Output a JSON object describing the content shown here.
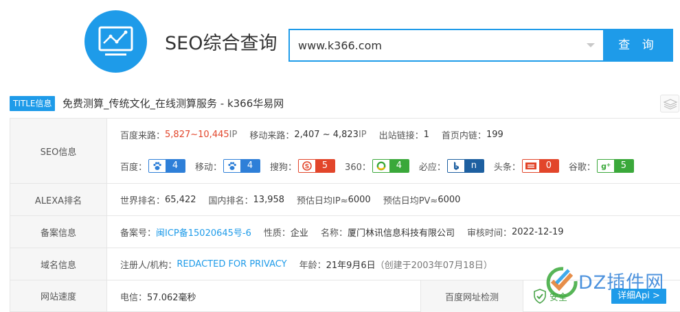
{
  "header": {
    "app_title": "SEO综合查询",
    "search_value": "www.k366.com",
    "search_button": "查 询"
  },
  "title_row": {
    "badge": "TITLE信息",
    "text": "免费测算_传统文化_在线测算服务 - k366华易网"
  },
  "seo": {
    "label": "SEO信息",
    "baidu_traffic_label": "百度来路：",
    "baidu_traffic_min": "5,827",
    "baidu_traffic_sep": " ~ ",
    "baidu_traffic_max": "10,445",
    "baidu_traffic_unit": " IP",
    "mobile_traffic_label": "移动来路：",
    "mobile_traffic_value": "2,407 ~ 4,823",
    "mobile_traffic_unit": " IP",
    "outlinks_label": "出站链接：",
    "outlinks_value": "1",
    "homepage_links_label": "首页内链：",
    "homepage_links_value": "199",
    "ranks": [
      {
        "label": "百度：",
        "icon": "paw-icon",
        "value": "4",
        "color": "#2e7fd8"
      },
      {
        "label": "移动：",
        "icon": "paw-icon",
        "value": "4",
        "color": "#2e7fd8"
      },
      {
        "label": "搜狗：",
        "icon": "sogou-icon",
        "value": "5",
        "color": "#e2452a"
      },
      {
        "label": "360：",
        "icon": "360-icon",
        "value": "4",
        "color": "#3aa83a"
      },
      {
        "label": "必应：",
        "icon": "bing-icon",
        "value": "n",
        "color": "#1d5fa0"
      },
      {
        "label": "头条：",
        "icon": "toutiao-icon",
        "value": "0",
        "color": "#e2452a"
      },
      {
        "label": "谷歌：",
        "icon": "google-plus-icon",
        "value": "5",
        "color": "#3aa83a"
      }
    ]
  },
  "alexa": {
    "label": "ALEXA排名",
    "world_label": "世界排名：",
    "world_value": "65,422",
    "domestic_label": "国内排名：",
    "domestic_value": "13,958",
    "ip_label": "预估日均IP≈",
    "ip_value": "6000",
    "pv_label": "预估日均PV≈",
    "pv_value": "6000"
  },
  "icp": {
    "label": "备案信息",
    "number_label": "备案号：",
    "number_value": "闽ICP备15020645号-6",
    "nature_label": "性质：",
    "nature_value": "企业",
    "name_label": "名称：",
    "name_value": "厦门林讯信息科技有限公司",
    "audit_label": "审核时间：",
    "audit_value": "2022-12-19"
  },
  "domain": {
    "label": "域名信息",
    "registrant_label": "注册人/机构：",
    "registrant_value": "REDACTED FOR PRIVACY",
    "age_label": "年龄：",
    "age_value": "21年9月6日",
    "created_text": "（创建于2003年07月18日）"
  },
  "speed": {
    "label": "网站速度",
    "telecom_label": "电信：",
    "telecom_value": "57.062毫秒",
    "baidu_check_label": "百度网址检测",
    "safe_text": "安全",
    "api_button": "详细Api >"
  },
  "watermark": {
    "text": "DZ插件网"
  },
  "colors": {
    "accent": "#1e9be9",
    "red": "#e2452a",
    "green": "#3aa83a"
  }
}
